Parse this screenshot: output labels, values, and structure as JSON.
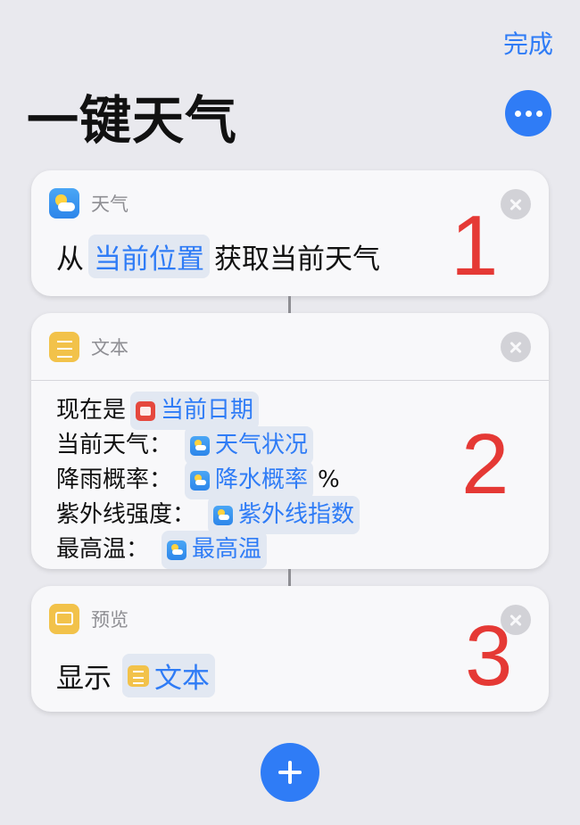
{
  "header": {
    "done_label": "完成",
    "title": "一键天气"
  },
  "card1": {
    "app_label": "天气",
    "prefix": "从",
    "token": "当前位置",
    "suffix": "获取当前天气",
    "number": "1"
  },
  "card2": {
    "app_label": "文本",
    "lines": [
      {
        "label": "现在是",
        "token": "当前日期",
        "suffix": ""
      },
      {
        "label": "当前天气：",
        "token": "天气状况",
        "suffix": ""
      },
      {
        "label": "降雨概率：",
        "token": "降水概率",
        "suffix": "%"
      },
      {
        "label": "紫外线强度：",
        "token": "紫外线指数",
        "suffix": ""
      },
      {
        "label": "最高温：",
        "token": "最高温",
        "suffix": ""
      }
    ],
    "number": "2"
  },
  "card3": {
    "app_label": "预览",
    "prefix": "显示",
    "token": "文本",
    "number": "3"
  },
  "icons": {
    "more": "ellipsis-icon",
    "close": "close-icon",
    "add": "plus-icon"
  },
  "colors": {
    "accent": "#2f7cf6",
    "annotation": "#e53935",
    "background": "#e9e9ee"
  }
}
